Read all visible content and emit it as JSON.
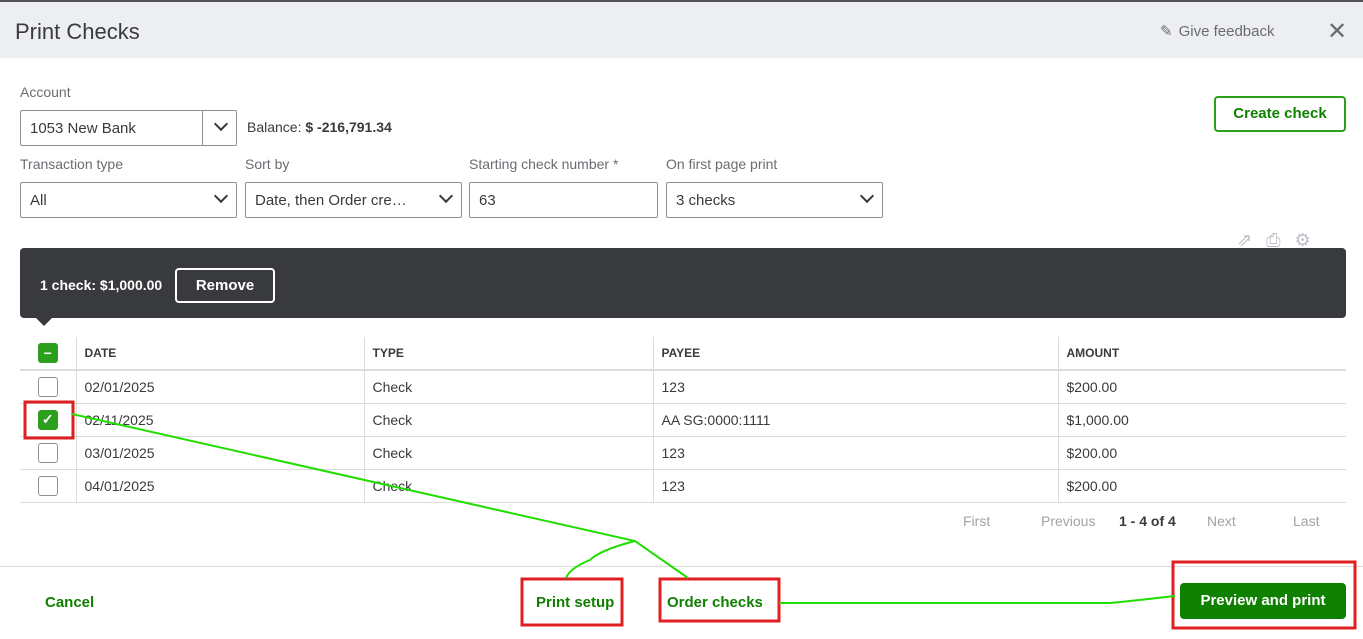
{
  "header": {
    "title": "Print Checks",
    "feedback": "Give feedback"
  },
  "filters": {
    "account_label": "Account",
    "account_value": "1053 New Bank",
    "balance_label": "Balance:",
    "balance_value": "$ -216,791.34",
    "create_check": "Create check",
    "type_label": "Transaction type",
    "type_value": "All",
    "sort_label": "Sort by",
    "sort_value": "Date, then Order cre…",
    "start_label": "Starting check number *",
    "start_value": "63",
    "first_label": "On first page print",
    "first_value": "3 checks"
  },
  "selection": {
    "summary": "1 check: $1,000.00",
    "remove": "Remove"
  },
  "table": {
    "columns": [
      "DATE",
      "TYPE",
      "PAYEE",
      "AMOUNT"
    ],
    "rows": [
      {
        "date": "02/01/2025",
        "type": "Check",
        "payee": "123",
        "amount": "$200.00",
        "checked": false
      },
      {
        "date": "02/11/2025",
        "type": "Check",
        "payee": "AA SG:0000:1111",
        "amount": "$1,000.00",
        "checked": true
      },
      {
        "date": "03/01/2025",
        "type": "Check",
        "payee": "123",
        "amount": "$200.00",
        "checked": false
      },
      {
        "date": "04/01/2025",
        "type": "Check",
        "payee": "123",
        "amount": "$200.00",
        "checked": false
      }
    ]
  },
  "pagination": {
    "first": "First",
    "previous": "Previous",
    "range": "1 - 4 of 4",
    "next": "Next",
    "last": "Last"
  },
  "footer": {
    "cancel": "Cancel",
    "print_setup": "Print setup",
    "order_checks": "Order checks",
    "preview": "Preview and print"
  }
}
